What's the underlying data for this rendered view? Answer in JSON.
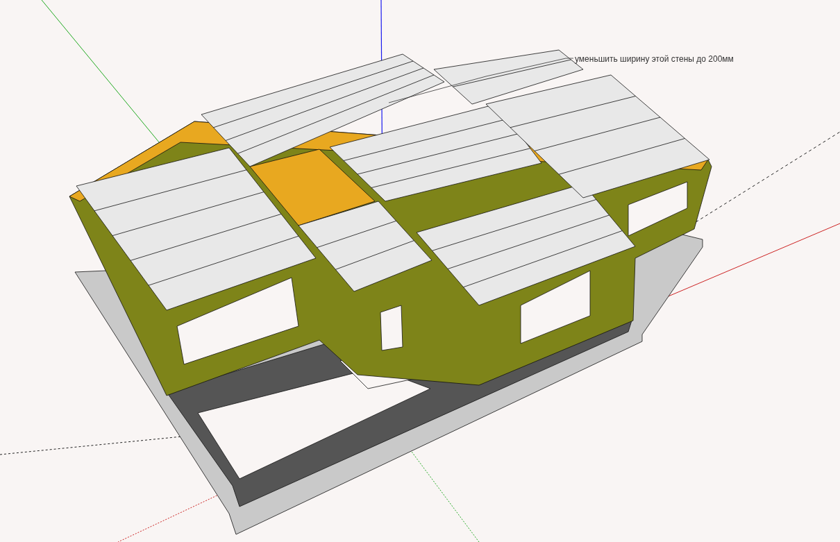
{
  "viewport": {
    "annotation": {
      "text": "уменьшить ширину этой стены до 200мм"
    }
  }
}
